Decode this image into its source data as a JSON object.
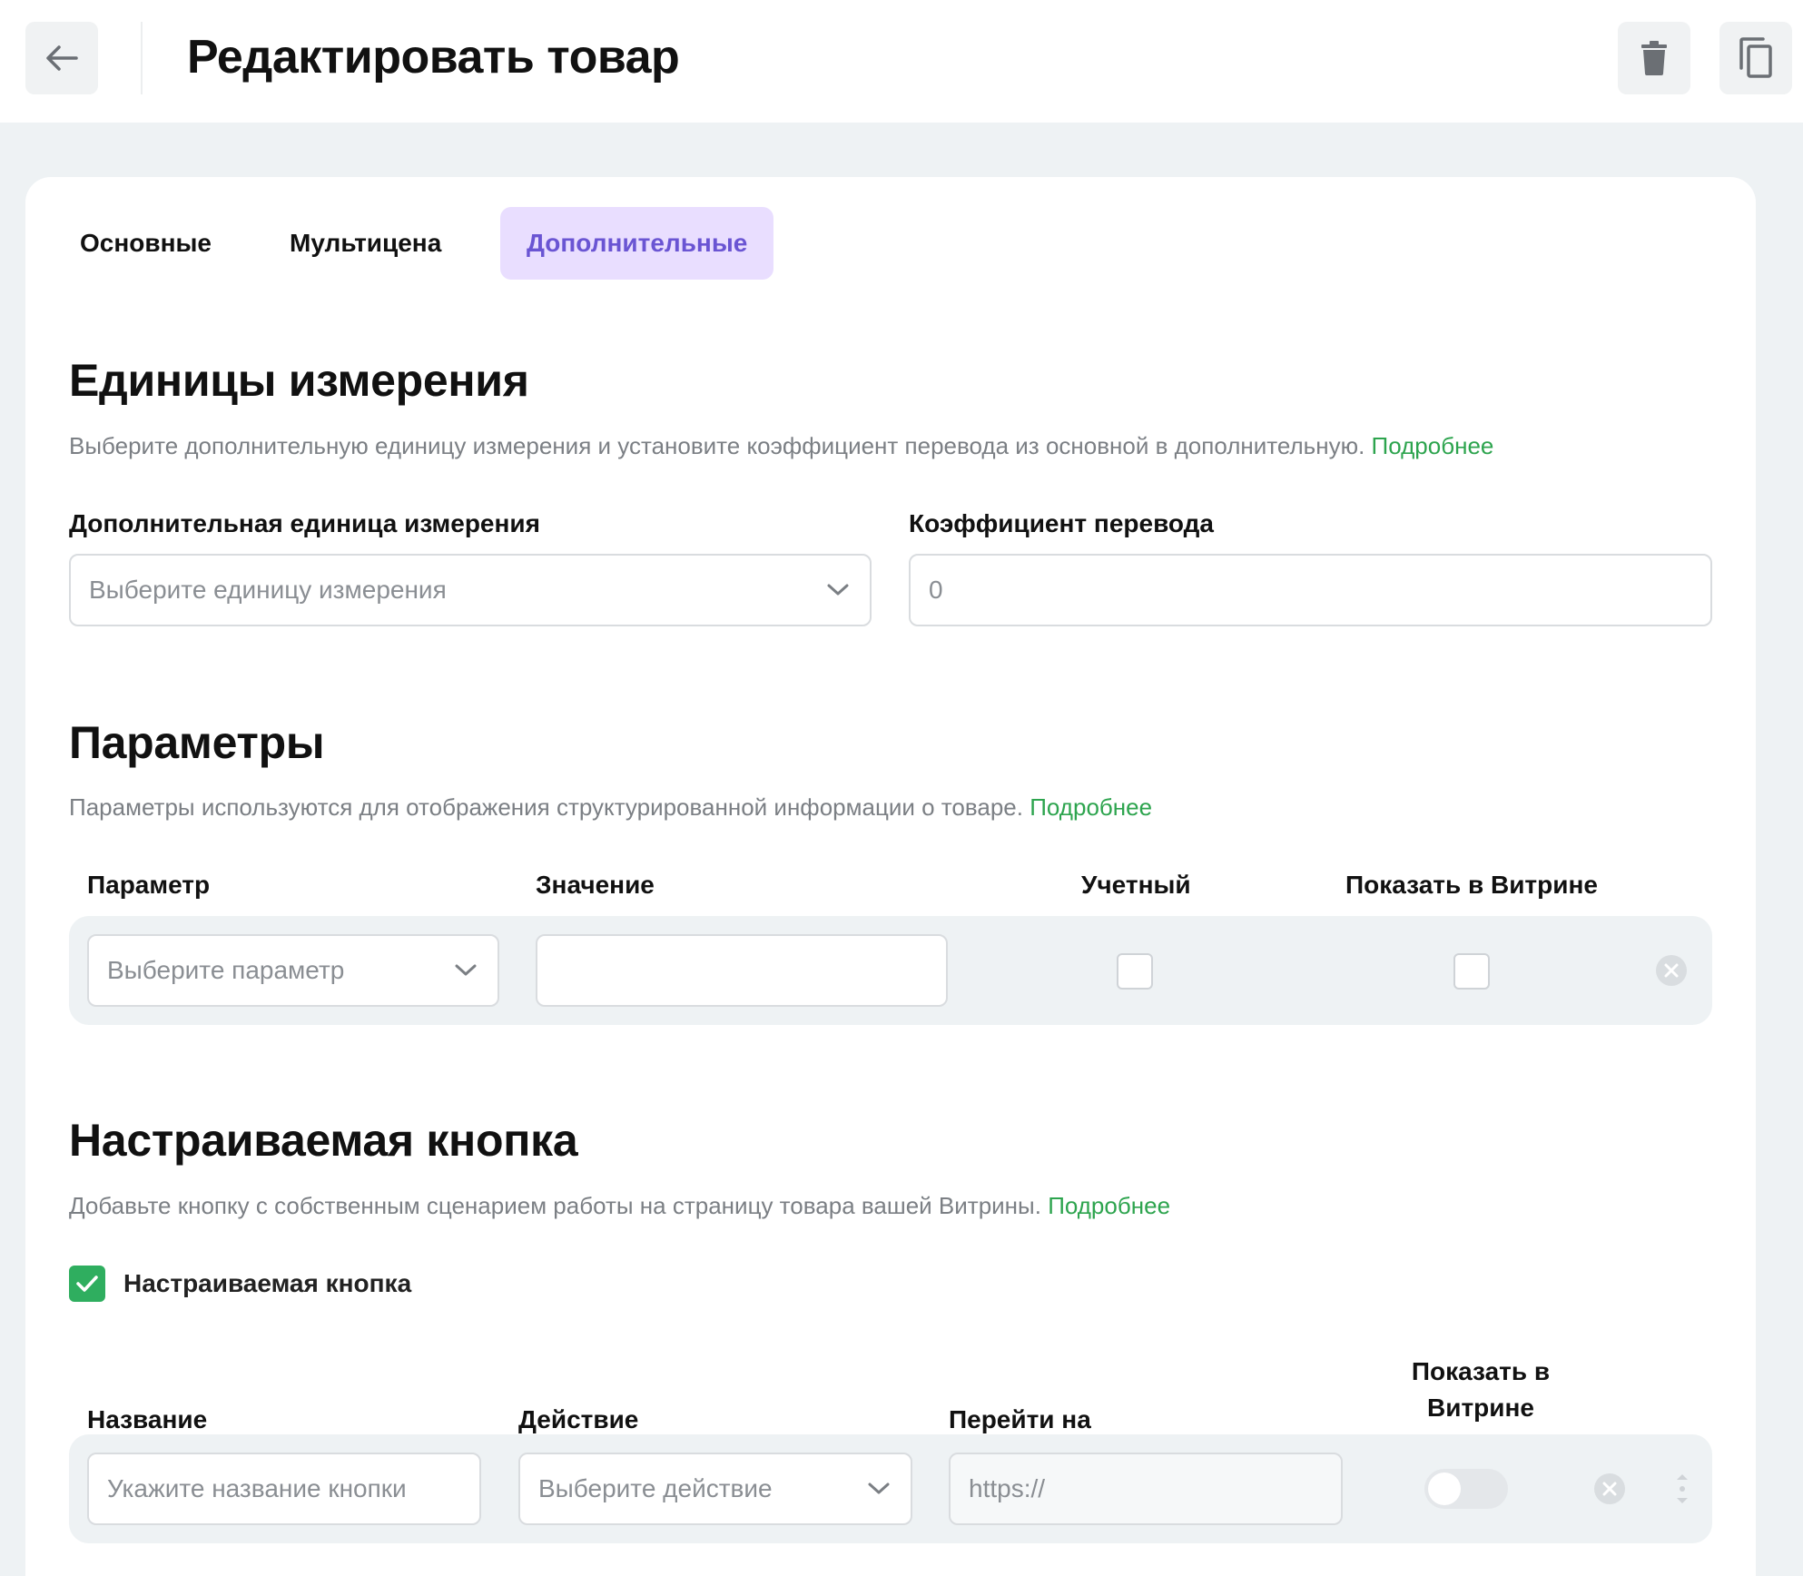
{
  "header": {
    "title": "Редактировать товар"
  },
  "tabs": [
    {
      "label": "Основные",
      "active": false
    },
    {
      "label": "Мультицена",
      "active": false
    },
    {
      "label": "Дополнительные",
      "active": true
    }
  ],
  "units": {
    "title": "Единицы измерения",
    "description": "Выберите дополнительную единицу измерения и установите коэффициент перевода из основной в дополнительную.",
    "more_link": "Подробнее",
    "extra_unit_label": "Дополнительная единица измерения",
    "extra_unit_placeholder": "Выберите единицу измерения",
    "ratio_label": "Коэффициент перевода",
    "ratio_value": "0"
  },
  "params": {
    "title": "Параметры",
    "description": "Параметры используются для отображения структурированной информации о товаре.",
    "more_link": "Подробнее",
    "columns": {
      "param": "Параметр",
      "value": "Значение",
      "accounting": "Учетный",
      "show_storefront": "Показать в Витрине"
    },
    "row": {
      "param_placeholder": "Выберите параметр",
      "value": "",
      "accounting_checked": false,
      "show_checked": false
    }
  },
  "custom_button": {
    "title": "Настраиваемая кнопка",
    "description": "Добавьте кнопку с собственным сценарием работы на страницу товара вашей Витрины.",
    "more_link": "Подробнее",
    "enable_label": "Настраиваемая кнопка",
    "enabled": true,
    "columns": {
      "name": "Название",
      "action": "Действие",
      "goto": "Перейти на",
      "show_line1": "Показать в",
      "show_line2": "Витрине"
    },
    "row": {
      "name_placeholder": "Укажите название кнопки",
      "action_placeholder": "Выберите действие",
      "goto_placeholder": "https://",
      "show_enabled": false
    }
  },
  "colors": {
    "accent_purple": "#6a55d3",
    "tab_active_bg": "#e9deff",
    "link_green": "#2da44e",
    "check_green": "#2fae5f"
  },
  "icons": [
    "arrow-left-icon",
    "trash-icon",
    "copy-icon",
    "chevron-down-icon",
    "close-circle-icon",
    "check-icon",
    "drag-handle-icon"
  ]
}
